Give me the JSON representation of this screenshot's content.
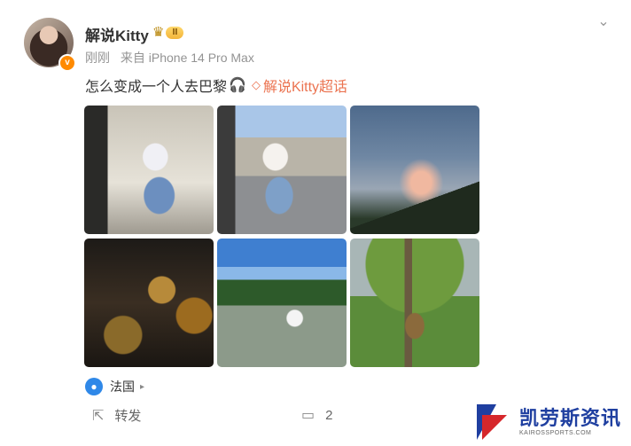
{
  "post": {
    "username": "解说Kitty",
    "vip_level": "II",
    "avatar_badge": "v",
    "time": "刚刚",
    "source": "来自 iPhone 14 Pro Max",
    "text": "怎么变成一个人去巴黎",
    "topic_link": "解说Kitty超话",
    "location": "法国"
  },
  "photos": [
    "photo-1",
    "photo-2",
    "photo-3",
    "photo-4",
    "photo-5",
    "photo-6"
  ],
  "actions": {
    "forward_label": "转发",
    "comment_count": "2"
  },
  "watermark": {
    "cn": "凯劳斯资讯",
    "en": "KAIROSSPORTS.COM"
  },
  "icons": {
    "chevron": "chevron-down-icon",
    "headphone": "headphone-icon",
    "topic": "diamond-icon",
    "location": "location-pin-icon",
    "forward": "forward-icon",
    "comment": "comment-icon"
  },
  "colors": {
    "topic_link": "#eb7350",
    "location_pin": "#2f88e8",
    "watermark_blue": "#1f3fa0",
    "watermark_red": "#d6272b"
  }
}
